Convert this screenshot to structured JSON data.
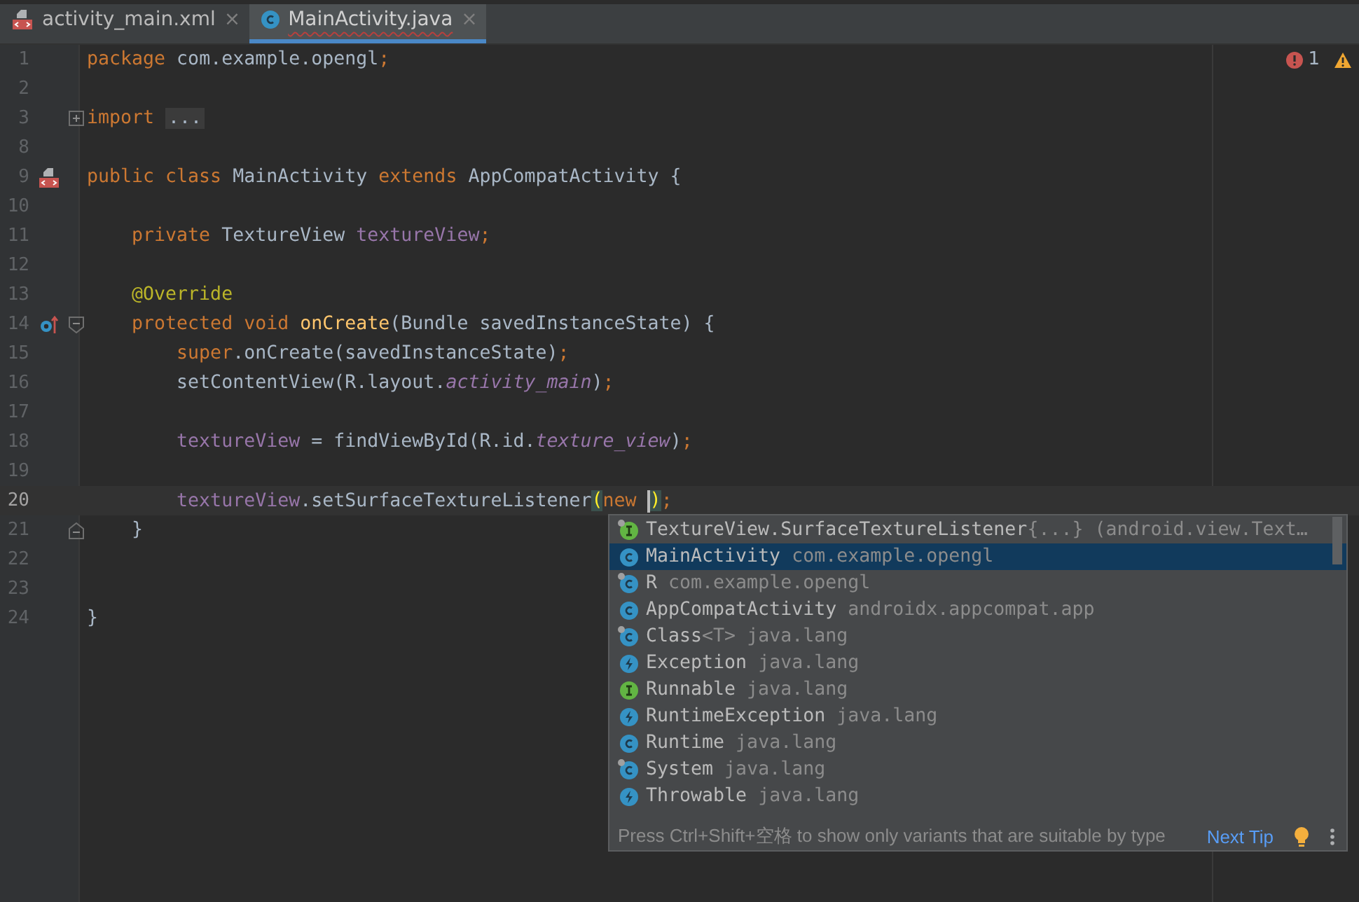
{
  "tabs": [
    {
      "label": "activity_main.xml",
      "kind": "layout",
      "selected": false,
      "has_error": false,
      "close": "×"
    },
    {
      "label": "MainActivity.java",
      "kind": "class",
      "selected": true,
      "has_error": true,
      "close": "×"
    }
  ],
  "inspections": {
    "errors": "1"
  },
  "editor": {
    "lines": [
      {
        "number": "1",
        "kind": "code",
        "current": false,
        "tokens": [
          {
            "kind": "keyword",
            "text": "package"
          },
          {
            "kind": "plain",
            "text": " com.example.opengl"
          },
          {
            "kind": "keyword",
            "text": ";"
          }
        ]
      },
      {
        "number": "2",
        "kind": "blank",
        "current": false
      },
      {
        "number": "3",
        "kind": "import",
        "folded": true,
        "current": false,
        "tokens": [
          {
            "kind": "keyword",
            "text": "import "
          },
          {
            "kind": "folded",
            "text": "..."
          }
        ]
      },
      {
        "number": "8",
        "kind": "blank",
        "current": false
      },
      {
        "number": "9",
        "kind": "declaration",
        "current": false,
        "tokens": [
          {
            "kind": "keyword",
            "text": "public class"
          },
          {
            "kind": "plain",
            "text": " MainActivity "
          },
          {
            "kind": "keyword",
            "text": "extends"
          },
          {
            "kind": "plain",
            "text": " AppCompatActivity {"
          }
        ]
      },
      {
        "number": "10",
        "kind": "blank",
        "current": false
      },
      {
        "number": "11",
        "kind": "code",
        "current": false,
        "tokens": [
          {
            "kind": "keyword",
            "text": "    private"
          },
          {
            "kind": "plain",
            "text": " TextureView "
          },
          {
            "kind": "field",
            "text": "textureView"
          },
          {
            "kind": "keyword",
            "text": ";"
          }
        ]
      },
      {
        "number": "12",
        "kind": "blank",
        "current": false
      },
      {
        "number": "13",
        "kind": "code",
        "current": false,
        "tokens": [
          {
            "kind": "annotation",
            "text": "    @Override"
          }
        ]
      },
      {
        "number": "14",
        "kind": "method",
        "folded": false,
        "current": false,
        "tokens": [
          {
            "kind": "keyword",
            "text": "    protected void "
          },
          {
            "kind": "method",
            "text": "onCreate"
          },
          {
            "kind": "plain",
            "text": "(Bundle savedInstanceState) {"
          }
        ]
      },
      {
        "number": "15",
        "kind": "code",
        "current": false,
        "tokens": [
          {
            "kind": "keyword",
            "text": "        super"
          },
          {
            "kind": "plain",
            "text": ".onCreate(savedInstanceState)"
          },
          {
            "kind": "keyword",
            "text": ";"
          }
        ]
      },
      {
        "number": "16",
        "kind": "code",
        "current": false,
        "tokens": [
          {
            "kind": "plain",
            "text": "        setContentView(R.layout."
          },
          {
            "kind": "static",
            "text": "activity_main"
          },
          {
            "kind": "plain",
            "text": ")"
          },
          {
            "kind": "keyword",
            "text": ";"
          }
        ]
      },
      {
        "number": "17",
        "kind": "blank",
        "current": false
      },
      {
        "number": "18",
        "kind": "code",
        "current": false,
        "tokens": [
          {
            "kind": "field",
            "text": "        textureView"
          },
          {
            "kind": "plain",
            "text": " = findViewById(R.id."
          },
          {
            "kind": "static",
            "text": "texture_view"
          },
          {
            "kind": "plain",
            "text": ")"
          },
          {
            "kind": "keyword",
            "text": ";"
          }
        ]
      },
      {
        "number": "19",
        "kind": "blank",
        "current": false
      },
      {
        "number": "20",
        "kind": "code",
        "current": true,
        "tokens": [
          {
            "kind": "field",
            "text": "        textureView"
          },
          {
            "kind": "plain",
            "text": ".setSurfaceTextureListener"
          },
          {
            "kind": "brace",
            "text": "("
          },
          {
            "kind": "keyword",
            "text": "new "
          },
          {
            "kind": "caret"
          },
          {
            "kind": "brace",
            "text": ")"
          },
          {
            "kind": "keyword",
            "text": ";"
          }
        ]
      },
      {
        "number": "21",
        "kind": "block_end",
        "current": false,
        "tokens": [
          {
            "kind": "plain",
            "text": "    }"
          }
        ]
      },
      {
        "number": "22",
        "kind": "blank",
        "current": false
      },
      {
        "number": "23",
        "kind": "blank",
        "current": false
      },
      {
        "number": "24",
        "kind": "code",
        "current": false,
        "tokens": [
          {
            "kind": "plain",
            "text": "}"
          }
        ]
      }
    ]
  },
  "completion": {
    "items": [
      {
        "kind": "interface",
        "pinned": true,
        "name": "TextureView.SurfaceTextureListener",
        "suffix": "{...}",
        "detail": "(android.view.Text…",
        "selected": false
      },
      {
        "kind": "class",
        "pinned": false,
        "name": "MainActivity",
        "detail": "com.example.opengl",
        "selected": true
      },
      {
        "kind": "class",
        "pinned": true,
        "name": "R",
        "detail": "com.example.opengl",
        "selected": false
      },
      {
        "kind": "class",
        "pinned": false,
        "name": "AppCompatActivity",
        "detail": "androidx.appcompat.app",
        "selected": false
      },
      {
        "kind": "class",
        "pinned": true,
        "name": "Class",
        "suffix": "<T>",
        "detail": "java.lang",
        "selected": false
      },
      {
        "kind": "exception",
        "pinned": false,
        "name": "Exception",
        "detail": "java.lang",
        "selected": false
      },
      {
        "kind": "interface",
        "pinned": false,
        "name": "Runnable",
        "detail": "java.lang",
        "selected": false
      },
      {
        "kind": "exception",
        "pinned": false,
        "name": "RuntimeException",
        "detail": "java.lang",
        "selected": false
      },
      {
        "kind": "class",
        "pinned": false,
        "name": "Runtime",
        "detail": "java.lang",
        "selected": false
      },
      {
        "kind": "class",
        "pinned": true,
        "name": "System",
        "detail": "java.lang",
        "selected": false
      },
      {
        "kind": "exception",
        "pinned": false,
        "name": "Throwable",
        "detail": "java.lang",
        "selected": false
      }
    ],
    "hint": "Press Ctrl+Shift+空格 to show only variants that are suitable by type",
    "next_tip": "Next Tip"
  }
}
